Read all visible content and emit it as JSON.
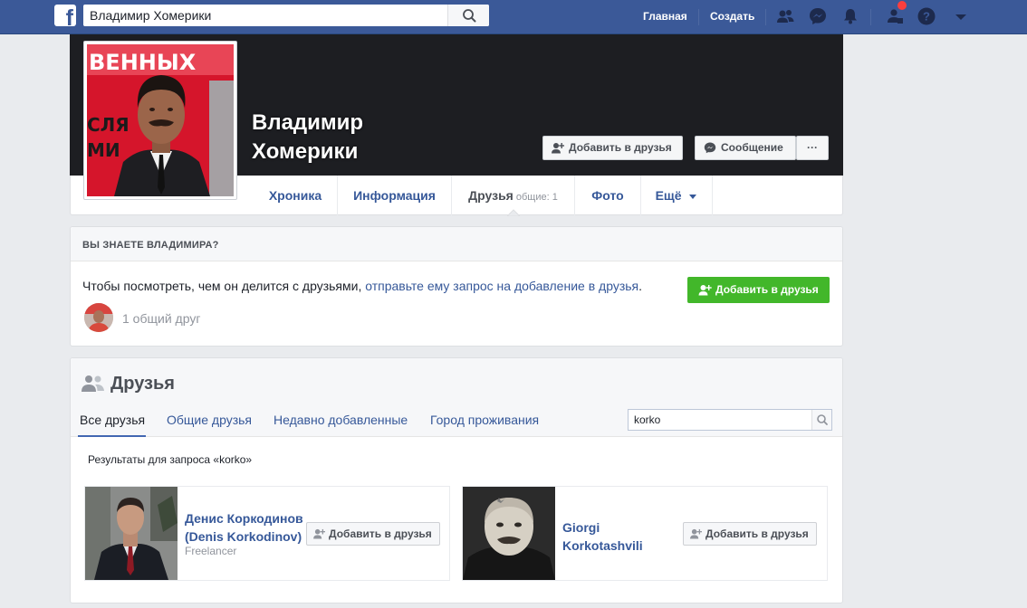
{
  "topbar": {
    "search_value": "Владимир Хомерики",
    "nav_home": "Главная",
    "nav_create": "Создать"
  },
  "profile": {
    "name": "Владимир Хомерики",
    "add_friend_label": "Добавить в друзья",
    "message_label": "Сообщение",
    "more_label": "···",
    "photo_poster_text": "ВЕННЫХ",
    "photo_poster_side": [
      "СЛЯ",
      "МИ"
    ]
  },
  "tabs": [
    {
      "label": "Хроника"
    },
    {
      "label": "Информация"
    },
    {
      "label": "Друзья",
      "extra": "общие: 1"
    },
    {
      "label": "Фото"
    },
    {
      "label": "Ещё"
    }
  ],
  "know": {
    "title": "Вы знаете Владимира?",
    "text_prefix": "Чтобы посмотреть, чем он делится с друзьями, ",
    "text_link": "отправьте ему запрос на добавление в друзья",
    "text_suffix": ".",
    "add_label": "Добавить в друзья",
    "mutual_text": "1 общий друг"
  },
  "friends": {
    "title": "Друзья",
    "tabs": [
      "Все друзья",
      "Общие друзья",
      "Недавно добавленные",
      "Город проживания"
    ],
    "search_value": "korko",
    "results_label": "Результаты для запроса «korko»",
    "items": [
      {
        "name_line1": "Денис Коркодинов",
        "name_line2": "(Denis Korkodinov)",
        "sub": "Freelancer",
        "add_label": "Добавить в друзья"
      },
      {
        "name_line1": "Giorgi",
        "name_line2": "Korkotashvili",
        "sub": "",
        "add_label": "Добавить в друзья"
      }
    ]
  },
  "colors": {
    "brand": "#3b5998",
    "link": "#365899",
    "green": "#42b72a",
    "notification": "#fa3e3e"
  },
  "icons": {
    "search": "search-icon",
    "friends": "friends-icon",
    "messenger": "messenger-icon",
    "notifications": "bell-icon",
    "friend_requests": "friend-requests-icon",
    "help": "help-icon",
    "dropdown": "chevron-down-icon",
    "add_friend": "add-friend-icon",
    "message": "message-icon"
  }
}
